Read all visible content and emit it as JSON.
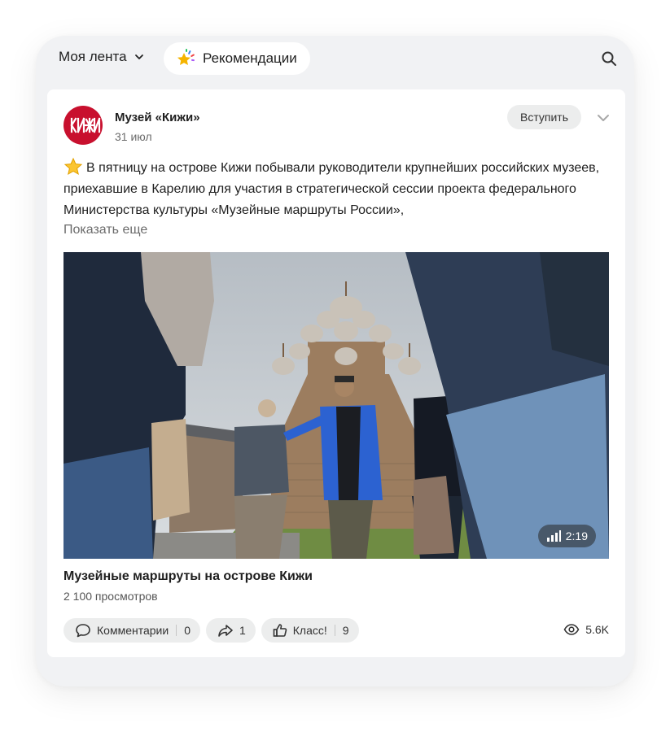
{
  "topbar": {
    "feed_label": "Моя лента",
    "recommendations_label": "Рекомендации"
  },
  "post": {
    "group_name": "Музей «Кижи»",
    "avatar_text": "КИЖИ",
    "date": "31 июл",
    "join_label": "Вступить",
    "text": "В пятницу на острове Кижи побывали руководители крупнейших российских музеев, приехавшие в Карелию для участия в стратегической сессии проекта федерального Министерства культуры «Музейные маршруты России»,",
    "show_more": "Показать еще",
    "video": {
      "duration": "2:19",
      "title": "Музейные маршруты на острове Кижи",
      "views": "2 100 просмотров"
    },
    "actions": {
      "comments_label": "Комментарии",
      "comments_count": "0",
      "shares_count": "1",
      "like_label": "Класс!",
      "like_count": "9"
    },
    "total_views": "5.6K"
  },
  "icons": [
    "chevron-down-icon",
    "sparkle-star-icon",
    "search-icon",
    "star-emoji-icon",
    "signal-bars-icon",
    "comment-icon",
    "share-icon",
    "thumbs-up-icon",
    "eye-icon"
  ],
  "colors": {
    "brand_red": "#c8102e",
    "background": "#f1f2f4",
    "pill": "#eceded"
  }
}
